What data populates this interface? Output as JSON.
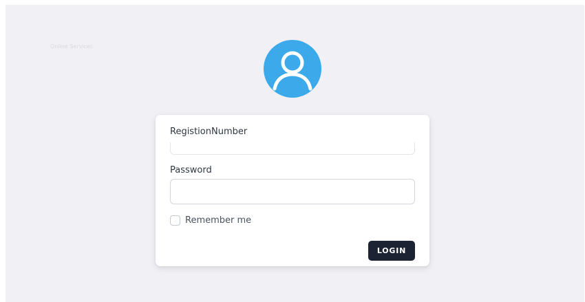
{
  "header": {
    "faint_text": "Online Services"
  },
  "avatar": {
    "icon": "user-icon",
    "color": "#3ba9ea"
  },
  "login_form": {
    "registration_label": "RegistionNumber",
    "registration_value": "",
    "password_label": "Password",
    "password_value": "",
    "remember_label": "Remember me",
    "remember_checked": false,
    "login_button_label": "LOGIN",
    "button_color": "#1c2433"
  }
}
